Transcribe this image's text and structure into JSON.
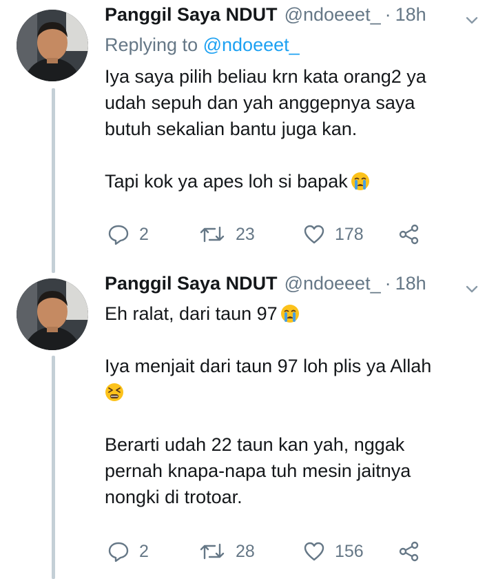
{
  "colors": {
    "text": "#14171a",
    "secondary": "#657786",
    "link": "#1da1f2",
    "thread_line": "#c4cfd6"
  },
  "tweets": [
    {
      "author_name": "Panggil Saya NDUT",
      "handle": "@ndoeeet_",
      "separator": "·",
      "time": "18h",
      "reply_prefix": "Replying to",
      "reply_mention": "@ndoeeet_",
      "text_lines": [
        "Iya saya pilih beliau krn kata orang2 ya",
        "udah sepuh dan yah anggepnya saya",
        "butuh sekalian bantu juga kan."
      ],
      "text_line_2": "Tapi kok ya apes loh si bapak",
      "emoji_1": "crying-face-emoji",
      "replies": "2",
      "retweets": "23",
      "likes": "178"
    },
    {
      "author_name": "Panggil Saya NDUT",
      "handle": "@ndoeeet_",
      "separator": "·",
      "time": "18h",
      "line_1": "Eh ralat, dari taun 97",
      "emoji_1": "crying-face-emoji",
      "line_2": "Iya menjait dari taun 97 loh plis ya Allah",
      "emoji_2": "tired-face-emoji",
      "text_lines": [
        "Berarti udah 22 taun kan yah, nggak",
        "pernah knapa-napa tuh mesin jaitnya",
        "nongki di trotoar."
      ],
      "replies": "2",
      "retweets": "28",
      "likes": "156"
    }
  ]
}
